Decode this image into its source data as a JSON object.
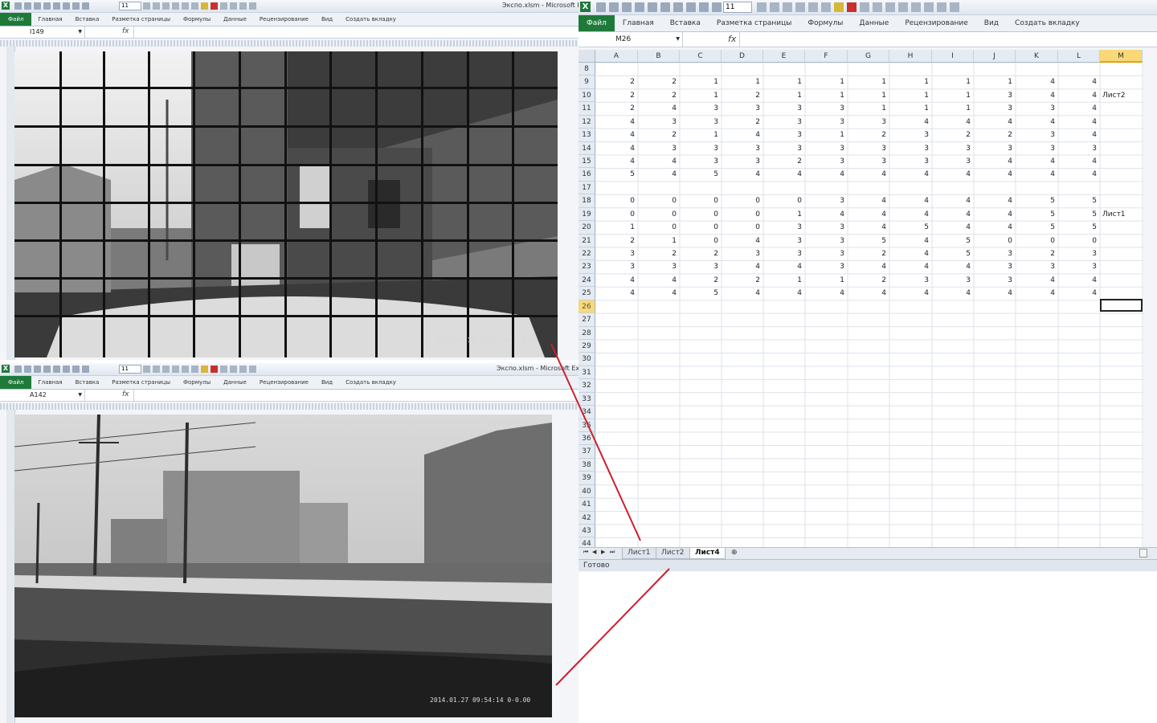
{
  "window_a": {
    "title": "Экспо.xlsm - Microsoft Ex",
    "font_size": "11",
    "name_box": "I149",
    "fx": "fx",
    "tabs": [
      "Файл",
      "Главная",
      "Вставка",
      "Разметка страницы",
      "Формулы",
      "Данные",
      "Рецензирование",
      "Вид",
      "Создать вкладку"
    ],
    "photo_timestamp": "2014.02.18 15:57:40 0-0.00"
  },
  "window_b": {
    "title": "Экспо.xlsm - Microsoft Exce",
    "font_size": "11",
    "name_box": "A142",
    "fx": "fx",
    "tabs": [
      "Файл",
      "Главная",
      "Вставка",
      "Разметка страницы",
      "Формулы",
      "Данные",
      "Рецензирование",
      "Вид",
      "Создать вкладку"
    ],
    "photo_timestamp": "2014.01.27 09:54:14 0-0.00"
  },
  "window_c": {
    "font_size": "11",
    "name_box": "M26",
    "fx": "fx",
    "tabs": [
      "Файл",
      "Главная",
      "Вставка",
      "Разметка страницы",
      "Формулы",
      "Данные",
      "Рецензирование",
      "Вид",
      "Создать вкладку"
    ],
    "columns": [
      "A",
      "B",
      "C",
      "D",
      "E",
      "F",
      "G",
      "H",
      "I",
      "J",
      "K",
      "L",
      "M"
    ],
    "selected_column": "M",
    "selected_row": "26",
    "row_numbers": [
      "8",
      "9",
      "10",
      "11",
      "12",
      "13",
      "14",
      "15",
      "16",
      "17",
      "18",
      "19",
      "20",
      "21",
      "22",
      "23",
      "24",
      "25",
      "26",
      "27",
      "28",
      "29",
      "30",
      "31",
      "32",
      "33",
      "34",
      "35",
      "36",
      "37",
      "38",
      "39",
      "40",
      "41",
      "42",
      "43",
      "44"
    ],
    "rows": [
      {
        "row": "9",
        "values": [
          "2",
          "2",
          "1",
          "1",
          "1",
          "1",
          "1",
          "1",
          "1",
          "1",
          "4",
          "4"
        ],
        "label": ""
      },
      {
        "row": "10",
        "values": [
          "2",
          "2",
          "1",
          "2",
          "1",
          "1",
          "1",
          "1",
          "1",
          "3",
          "4",
          "4"
        ],
        "label": "Лист2"
      },
      {
        "row": "11",
        "values": [
          "2",
          "4",
          "3",
          "3",
          "3",
          "3",
          "1",
          "1",
          "1",
          "3",
          "3",
          "4"
        ],
        "label": ""
      },
      {
        "row": "12",
        "values": [
          "4",
          "3",
          "3",
          "2",
          "3",
          "3",
          "3",
          "4",
          "4",
          "4",
          "4",
          "4"
        ],
        "label": ""
      },
      {
        "row": "13",
        "values": [
          "4",
          "2",
          "1",
          "4",
          "3",
          "1",
          "2",
          "3",
          "2",
          "2",
          "3",
          "4"
        ],
        "label": ""
      },
      {
        "row": "14",
        "values": [
          "4",
          "3",
          "3",
          "3",
          "3",
          "3",
          "3",
          "3",
          "3",
          "3",
          "3",
          "3"
        ],
        "label": ""
      },
      {
        "row": "15",
        "values": [
          "4",
          "4",
          "3",
          "3",
          "2",
          "3",
          "3",
          "3",
          "3",
          "4",
          "4",
          "4"
        ],
        "label": ""
      },
      {
        "row": "16",
        "values": [
          "5",
          "4",
          "5",
          "4",
          "4",
          "4",
          "4",
          "4",
          "4",
          "4",
          "4",
          "4"
        ],
        "label": ""
      },
      {
        "row": "18",
        "values": [
          "0",
          "0",
          "0",
          "0",
          "0",
          "3",
          "4",
          "4",
          "4",
          "4",
          "5",
          "5"
        ],
        "label": ""
      },
      {
        "row": "19",
        "values": [
          "0",
          "0",
          "0",
          "0",
          "1",
          "4",
          "4",
          "4",
          "4",
          "4",
          "5",
          "5"
        ],
        "label": "Лист1"
      },
      {
        "row": "20",
        "values": [
          "1",
          "0",
          "0",
          "0",
          "3",
          "3",
          "4",
          "5",
          "4",
          "4",
          "5",
          "5"
        ],
        "label": ""
      },
      {
        "row": "21",
        "values": [
          "2",
          "1",
          "0",
          "4",
          "3",
          "3",
          "5",
          "4",
          "5",
          "0",
          "0",
          "0"
        ],
        "label": ""
      },
      {
        "row": "22",
        "values": [
          "3",
          "2",
          "2",
          "3",
          "3",
          "3",
          "2",
          "4",
          "5",
          "3",
          "2",
          "3"
        ],
        "label": ""
      },
      {
        "row": "23",
        "values": [
          "3",
          "3",
          "3",
          "4",
          "4",
          "3",
          "4",
          "4",
          "4",
          "3",
          "3",
          "3"
        ],
        "label": ""
      },
      {
        "row": "24",
        "values": [
          "4",
          "4",
          "2",
          "2",
          "1",
          "1",
          "2",
          "3",
          "3",
          "3",
          "4",
          "4"
        ],
        "label": ""
      },
      {
        "row": "25",
        "values": [
          "4",
          "4",
          "5",
          "4",
          "4",
          "4",
          "4",
          "4",
          "4",
          "4",
          "4",
          "4"
        ],
        "label": ""
      }
    ],
    "sheet_tabs": [
      "Лист1",
      "Лист2",
      "Лист4"
    ],
    "active_sheet": "Лист4",
    "status": "Готово"
  },
  "colors": {
    "accent_file_tab": "#1f7a3a",
    "selected_header": "#f9d976",
    "annotation_line": "#cc1f2e"
  }
}
